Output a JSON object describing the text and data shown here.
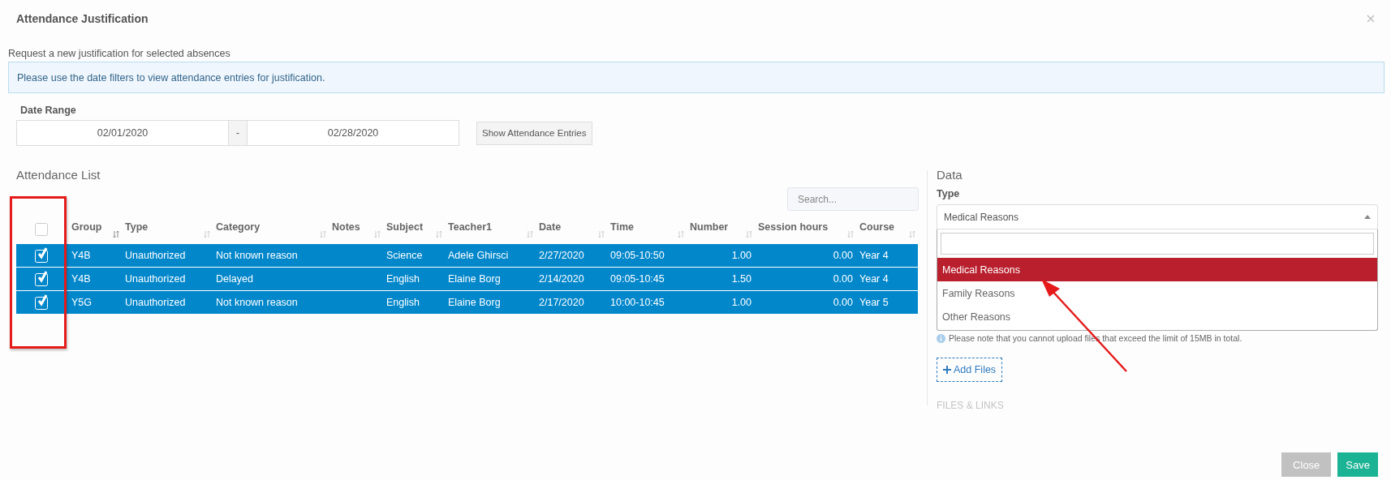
{
  "dialog": {
    "title": "Attendance Justification",
    "subtitle": "Request a new justification for selected absences",
    "info": "Please use the date filters to view attendance entries for justification.",
    "date_range": {
      "label": "Date Range",
      "from": "02/01/2020",
      "separator": "-",
      "to": "02/28/2020"
    },
    "show_button": "Show Attendance Entries",
    "attendance": {
      "title": "Attendance List",
      "search": {
        "placeholder": "Search..."
      },
      "all_checked": false,
      "columns": [
        {
          "label": "Group",
          "kind": "text",
          "sorted": true
        },
        {
          "label": "Type",
          "kind": "text",
          "sorted": false
        },
        {
          "label": "Category",
          "kind": "text",
          "sorted": false
        },
        {
          "label": "Notes",
          "kind": "text",
          "sorted": false
        },
        {
          "label": "Subject",
          "kind": "text",
          "sorted": false
        },
        {
          "label": "Teacher1",
          "kind": "text",
          "sorted": false
        },
        {
          "label": "Date",
          "kind": "text",
          "sorted": false
        },
        {
          "label": "Time",
          "kind": "text",
          "sorted": false
        },
        {
          "label": "Number",
          "kind": "number",
          "sorted": false
        },
        {
          "label": "Session hours",
          "kind": "number",
          "sorted": false
        },
        {
          "label": "Course",
          "kind": "text",
          "sorted": false
        }
      ],
      "rows": [
        {
          "selected": true,
          "checked": true,
          "cells": [
            "Y4B",
            "Unauthorized",
            "Not known reason",
            "",
            "Science",
            "Adele Ghirsci",
            "2/27/2020",
            "09:05-10:50",
            "1.00",
            "0.00",
            "Year 4"
          ]
        },
        {
          "selected": true,
          "checked": true,
          "cells": [
            "Y4B",
            "Unauthorized",
            "Delayed",
            "",
            "English",
            "Elaine Borg",
            "2/14/2020",
            "09:05-10:45",
            "1.50",
            "0.00",
            "Year 4"
          ]
        },
        {
          "selected": true,
          "checked": true,
          "cells": [
            "Y5G",
            "Unauthorized",
            "Not known reason",
            "",
            "English",
            "Elaine Borg",
            "2/17/2020",
            "10:00-10:45",
            "1.00",
            "0.00",
            "Year 5"
          ]
        }
      ]
    },
    "data": {
      "title": "Data",
      "type_label": "Type",
      "type_value": "Medical Reasons",
      "dropdown_open": true,
      "options": [
        {
          "label": "Medical Reasons",
          "selected": true
        },
        {
          "label": "Family Reasons",
          "selected": false
        },
        {
          "label": "Other Reasons",
          "selected": false
        }
      ],
      "note": "Please note that you cannot upload files that exceed the limit of 15MB in total.",
      "add_files": "Add Files",
      "files_links": "FILES & LINKS"
    },
    "buttons": [
      {
        "label": "Close",
        "kind": "secondary"
      },
      {
        "label": "Save",
        "kind": "primary"
      }
    ]
  }
}
